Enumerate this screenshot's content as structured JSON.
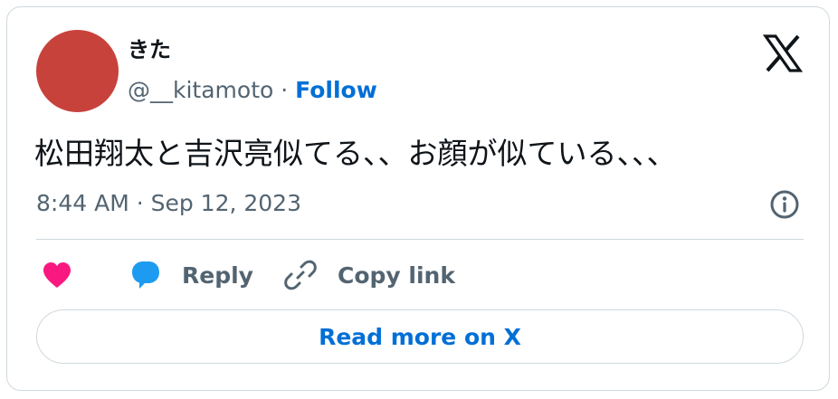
{
  "author": {
    "display_name": "きた",
    "handle": "@__kitamoto",
    "separator": "·",
    "follow_label": "Follow",
    "avatar_color": "#c8423c"
  },
  "tweet": {
    "text": "松田翔太と吉沢亮似てる、、お顔が似ている、、、",
    "timestamp": "8:44 AM · Sep 12, 2023"
  },
  "actions": {
    "like_icon": "heart-icon",
    "reply_label": "Reply",
    "reply_icon": "speech-bubble-icon",
    "copy_label": "Copy link",
    "copy_icon": "link-icon"
  },
  "footer": {
    "read_more_label": "Read more on X"
  },
  "colors": {
    "accent": "#006fd6",
    "like": "#f91880",
    "reply": "#1d9bf0",
    "muted": "#536471",
    "border": "#cfd9de"
  },
  "icons": {
    "brand": "x-logo-icon",
    "info": "info-icon"
  }
}
